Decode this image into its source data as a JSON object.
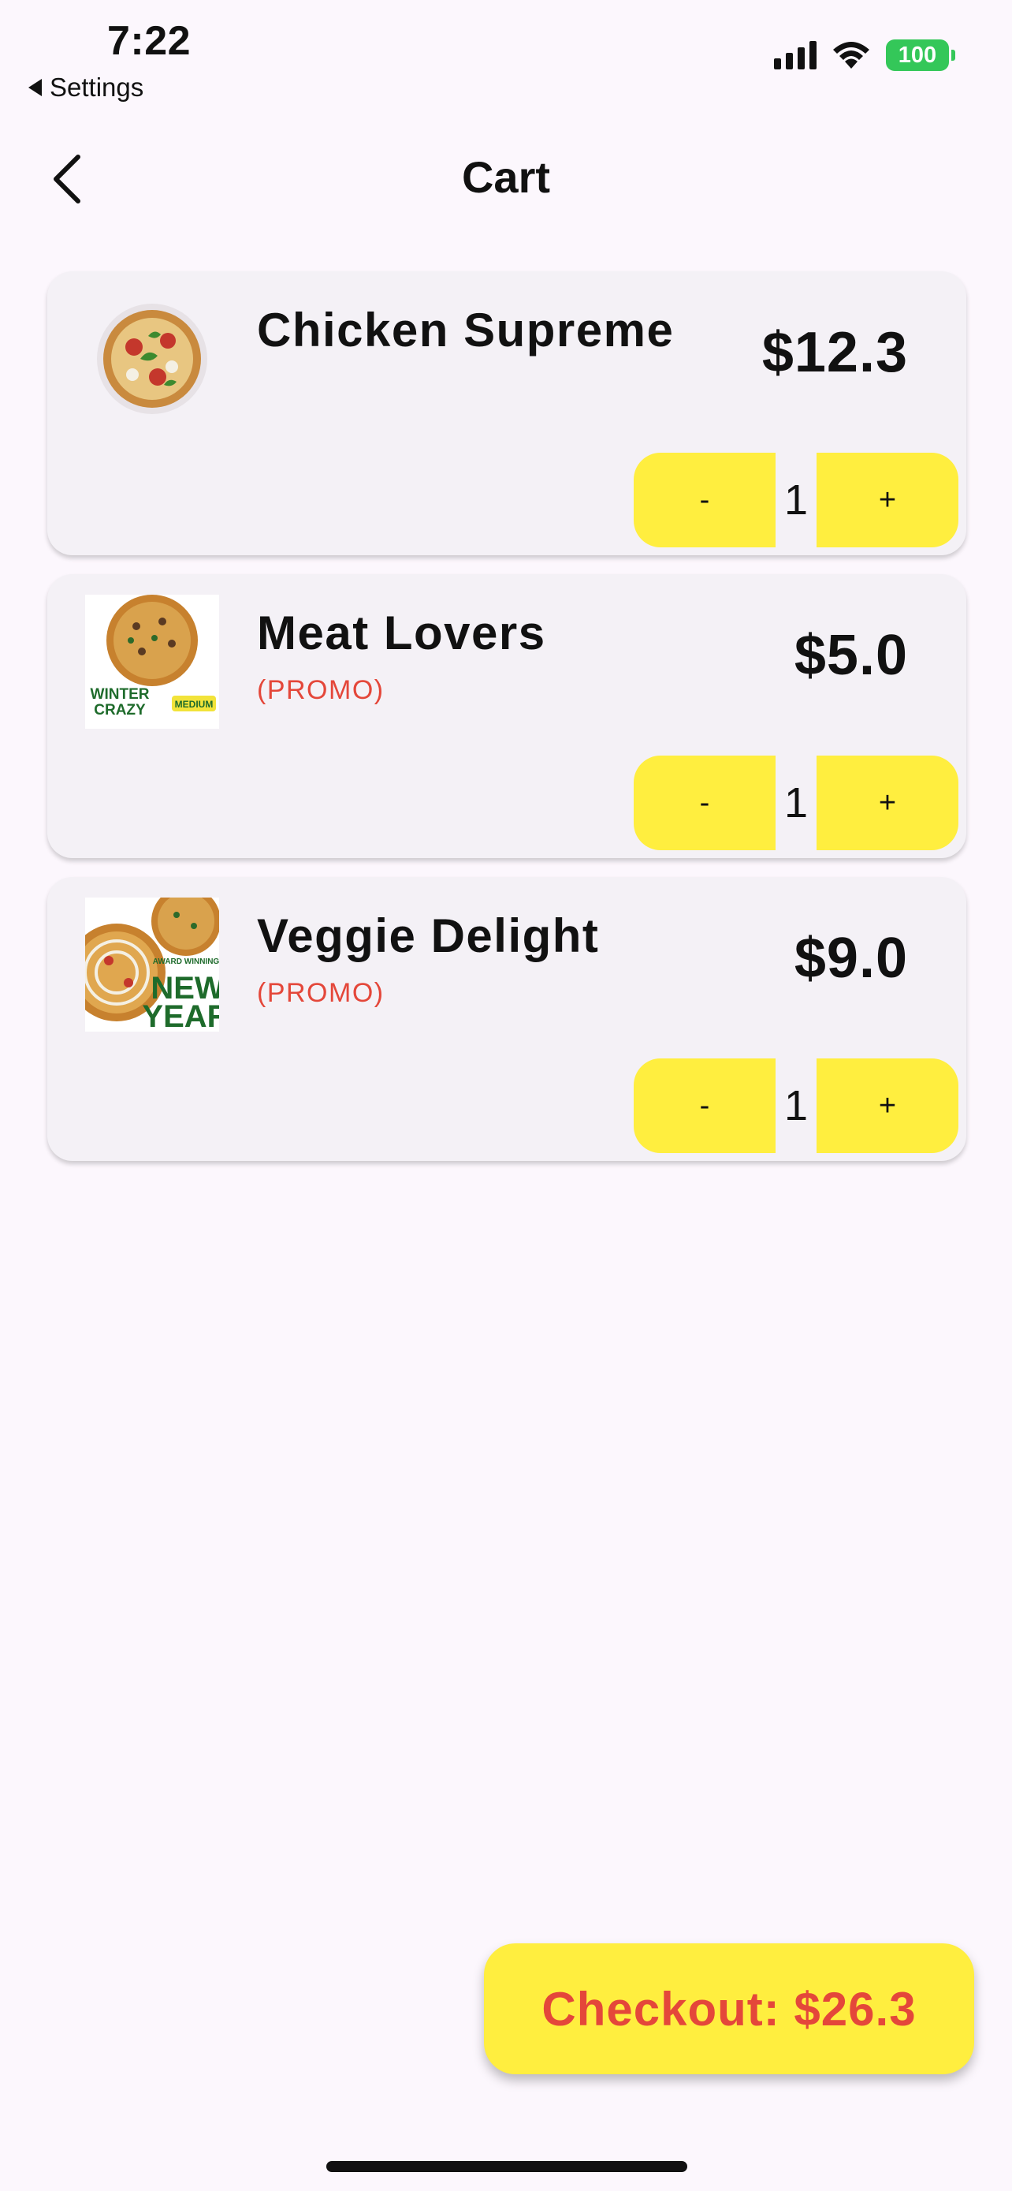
{
  "status_bar": {
    "time": "7:22",
    "back_label": "Settings",
    "battery": "100"
  },
  "header": {
    "title": "Cart"
  },
  "cart": {
    "items": [
      {
        "name": "Chicken Supreme",
        "promo": "",
        "price": "$12.3",
        "quantity": "1",
        "minus_label": "-",
        "plus_label": "+"
      },
      {
        "name": "Meat Lovers",
        "promo": "(PROMO)",
        "price": "$5.0",
        "quantity": "1",
        "minus_label": "-",
        "plus_label": "+",
        "image_text": [
          "WINTER",
          "CRAZY",
          "MEDIUM"
        ]
      },
      {
        "name": "Veggie Delight",
        "promo": "(PROMO)",
        "price": "$9.0",
        "quantity": "1",
        "minus_label": "-",
        "plus_label": "+",
        "image_text": [
          "AWARD WINNING",
          "NEW",
          "YEAR"
        ]
      }
    ]
  },
  "checkout": {
    "label": "Checkout: $26.3"
  },
  "colors": {
    "accent_yellow": "#ffee3f",
    "promo_red": "#e4473a",
    "card_bg": "#f4f1f6",
    "page_bg": "#fcf7fd",
    "battery_green": "#34c759"
  },
  "icons": {
    "back": "chevron-left-icon",
    "signal": "cellular-signal-icon",
    "wifi": "wifi-icon",
    "battery": "battery-icon"
  }
}
